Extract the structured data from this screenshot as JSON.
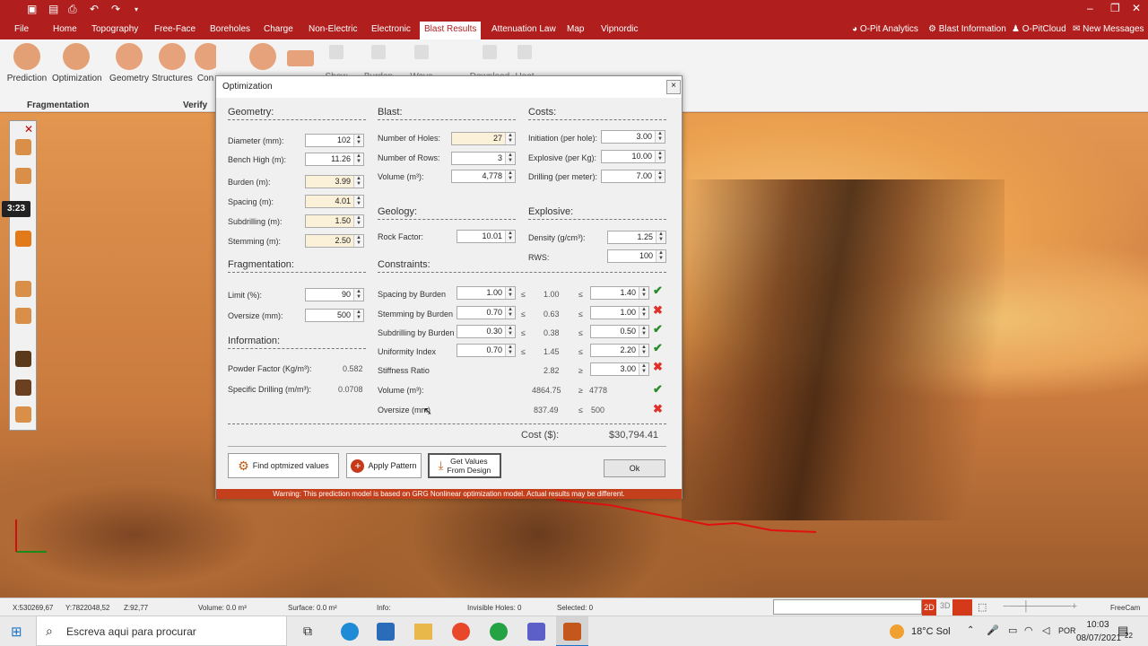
{
  "menu": {
    "file": "File",
    "items": [
      "Home",
      "Topography",
      "Free-Face",
      "Boreholes",
      "Charge",
      "Non-Electric",
      "Electronic",
      "Blast Results",
      "Attenuation Law",
      "Map",
      "Vipnordic"
    ],
    "right": [
      "O-Pit Analytics",
      "Blast Information",
      "O-PitCloud",
      "New Messages"
    ]
  },
  "ribbon": {
    "prediction": "Prediction",
    "optimization": "Optimization",
    "geometry": "Geometry",
    "structures": "Structures",
    "con": "Con",
    "show": "Show",
    "burden": "Burden",
    "wave": "Wave",
    "download": "Download",
    "heat": "Heat",
    "group_fragmentation": "Fragmentation",
    "group_verify": "Verify"
  },
  "overlay": {
    "timer": "3:23"
  },
  "dialog": {
    "title": "Optimization",
    "close": "×",
    "geometry": {
      "title": "Geometry:",
      "diameter_label": "Diameter (mm):",
      "diameter": "102",
      "bench_label": "Bench High (m):",
      "bench": "11.26",
      "burden_label": "Burden (m):",
      "burden": "3.99",
      "spacing_label": "Spacing  (m):",
      "spacing": "4.01",
      "subdrilling_label": "Subdrilling (m):",
      "subdrilling": "1.50",
      "stemming_label": "Stemming (m):",
      "stemming": "2.50"
    },
    "fragmentation": {
      "title": "Fragmentation:",
      "limit_label": "Limit (%):",
      "limit": "90",
      "oversize_label": "Oversize (mm):",
      "oversize": "500"
    },
    "information": {
      "title": "Information:",
      "powder_label": "Powder Factor (Kg/m³):",
      "powder": "0.582",
      "drilling_label": "Specific Drilling (m/m³):",
      "drilling": "0.0708"
    },
    "blast": {
      "title": "Blast:",
      "holes_label": "Number of Holes:",
      "holes": "27",
      "rows_label": "Number of Rows:",
      "rows": "3",
      "volume_label": "Volume (m³):",
      "volume": "4,778"
    },
    "costs": {
      "title": "Costs:",
      "initiation_label": "Initiation (per hole):",
      "initiation": "3.00",
      "explosive_label": "Explosive (per Kg):",
      "explosive": "10.00",
      "drilling_label": "Drilling (per meter):",
      "drilling": "7.00"
    },
    "geology": {
      "title": "Geology:",
      "rock_label": "Rock Factor:",
      "rock": "10.01"
    },
    "explosive": {
      "title": "Explosive:",
      "density_label": "Density (g/cm³):",
      "density": "1.25",
      "rws_label": "RWS:",
      "rws": "100"
    },
    "constraints": {
      "title": "Constraints:",
      "le": "≤",
      "ge": "≥",
      "rows": [
        {
          "label": "Spacing by Burden",
          "min": "1.00",
          "value": "1.00",
          "max": "1.40",
          "status": "ok"
        },
        {
          "label": "Stemming by Burden",
          "min": "0.70",
          "value": "0.63",
          "max": "1.00",
          "status": "bad"
        },
        {
          "label": "Subdrilling by Burden",
          "min": "0.30",
          "value": "0.38",
          "max": "0.50",
          "status": "ok"
        },
        {
          "label": "Uniformity Index",
          "min": "0.70",
          "value": "1.45",
          "max": "2.20",
          "status": "ok"
        },
        {
          "label": "Stiffness Ratio",
          "min": "",
          "value": "2.82",
          "max": "3.00",
          "status": "bad"
        },
        {
          "label": "Volume (m³):",
          "min": "",
          "value": "4864.75",
          "max": "4778",
          "status": "ok"
        },
        {
          "label": "Oversize (mm)",
          "min": "",
          "value": "837.49",
          "max": "500",
          "status": "bad"
        }
      ]
    },
    "cost_label": "Cost ($):",
    "cost": "$30,794.41",
    "buttons": {
      "find": "Find optmized values",
      "apply": "Apply Pattern",
      "get1": "Get Values",
      "get2": "From Design",
      "ok": "Ok"
    },
    "warning": "Warning: This prediction model is based on GRG Nonlinear optimization model. Actual results may be different."
  },
  "status": {
    "x": "X:530269,67",
    "y": "Y:7822048,52",
    "z": "Z:92,77",
    "volume": "Volume: 0.0 m³",
    "surface": "Surface: 0.0 m²",
    "info": "Info:",
    "invisible": "Invisible Holes: 0",
    "selected": "Selected: 0",
    "d2": "2D",
    "d3": "3D",
    "freecam": "FreeCam"
  },
  "taskbar": {
    "search": "Escreva aqui para procurar",
    "weather": "18°C  Sol",
    "lang": "POR",
    "time": "10:03",
    "date": "08/07/2021",
    "notif": "22"
  }
}
